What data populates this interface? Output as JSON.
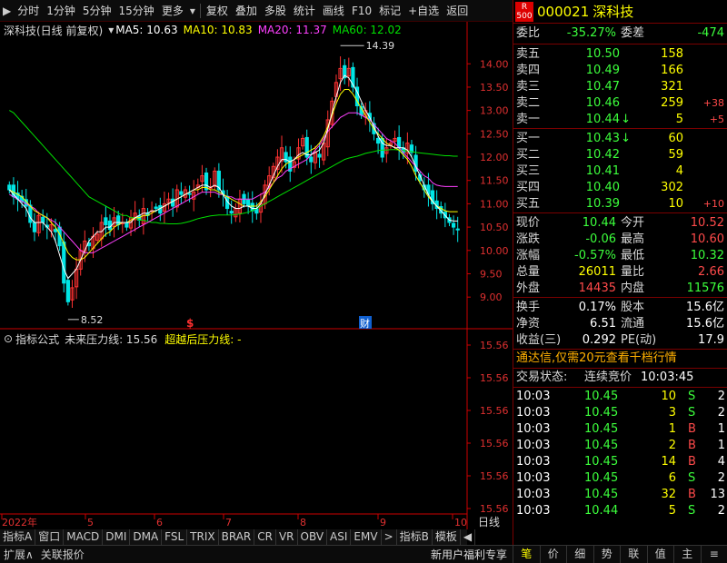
{
  "toolbar": {
    "items": [
      "分时",
      "1分钟",
      "5分钟",
      "15分钟",
      "更多",
      "复权",
      "叠加",
      "多股",
      "统计",
      "画线",
      "F10",
      "标记",
      "+自选",
      "返回"
    ]
  },
  "chart_header": {
    "stock_label": "深科技(日线 前复权)",
    "ma5": "MA5: 10.63",
    "ma10": "MA10: 10.83",
    "ma20": "MA20: 11.37",
    "ma60": "MA60: 12.02"
  },
  "indicator_header": {
    "label": "指标公式",
    "line1": "未来压力线: 15.56",
    "line2": "超越后压力线: -"
  },
  "colors": {
    "up": "#ff3232",
    "down": "#00e5e5",
    "ma5": "#ffffff",
    "ma10": "#ffff00",
    "ma20": "#ff40ff",
    "ma60": "#00e000",
    "axis": "#cc0000",
    "grid_text": "#e03030"
  },
  "chart_data": [
    {
      "type": "candlestick",
      "title": "深科技(日线 前复权)",
      "y_ticks": [
        14.0,
        13.5,
        13.0,
        12.5,
        12.0,
        11.5,
        11.0,
        10.5,
        10.0,
        9.5,
        9.0
      ],
      "ylim": [
        8.4,
        14.55
      ],
      "x_tick_labels": [
        "2022年",
        "5",
        "6",
        "7",
        "8",
        "9",
        "10"
      ],
      "high_marker": "14.39",
      "low_marker": "8.52",
      "event_markers": [
        "$",
        "财"
      ],
      "series": [
        {
          "name": "MA5",
          "value": 10.63
        },
        {
          "name": "MA10",
          "value": 10.83
        },
        {
          "name": "MA20",
          "value": 11.37
        },
        {
          "name": "MA60",
          "value": 12.02
        }
      ],
      "closes": [
        11.3,
        11.15,
        11.1,
        11.05,
        10.95,
        10.6,
        10.4,
        10.75,
        10.6,
        10.5,
        10.55,
        10.4,
        10.1,
        9.3,
        8.9,
        9.2,
        9.6,
        10.0,
        10.2,
        10.1,
        10.3,
        10.35,
        10.6,
        10.55,
        10.45,
        10.7,
        10.55,
        10.6,
        10.5,
        10.7,
        10.8,
        10.65,
        10.9,
        10.75,
        10.85,
        10.9,
        10.8,
        11.0,
        11.1,
        10.95,
        11.3,
        11.2,
        11.3,
        11.2,
        11.25,
        11.4,
        11.6,
        11.3,
        11.35,
        11.7,
        11.3,
        11.2,
        10.9,
        10.8,
        10.9,
        11.1,
        11.0,
        10.95,
        10.85,
        10.8,
        11.0,
        11.4,
        11.6,
        11.8,
        12.0,
        12.2,
        11.9,
        11.7,
        11.9,
        12.2,
        12.4,
        12.0,
        11.9,
        12.1,
        12.0,
        12.3,
        12.8,
        13.2,
        13.6,
        13.9,
        13.7,
        13.9,
        13.5,
        13.1,
        12.9,
        13.0,
        12.8,
        12.5,
        12.3,
        12.0,
        12.2,
        12.3,
        12.4,
        12.2,
        12.1,
        12.3,
        12.1,
        11.7,
        11.5,
        11.3,
        11.2,
        11.0,
        10.9,
        10.8,
        10.7,
        10.6,
        10.5,
        10.44
      ],
      "ma5": [
        11.3,
        11.2,
        11.1,
        11.0,
        10.9,
        10.7,
        10.6,
        10.6,
        10.6,
        10.5,
        10.4,
        10.2,
        9.9,
        9.6,
        9.4,
        9.5,
        9.6,
        9.8,
        10.0,
        10.2,
        10.3,
        10.4,
        10.4,
        10.5,
        10.5,
        10.6,
        10.6,
        10.6,
        10.6,
        10.6,
        10.7,
        10.75,
        10.8,
        10.8,
        10.85,
        10.85,
        10.9,
        10.95,
        11.0,
        11.05,
        11.1,
        11.15,
        11.2,
        11.25,
        11.3,
        11.35,
        11.4,
        11.4,
        11.35,
        11.4,
        11.35,
        11.2,
        11.05,
        10.95,
        10.9,
        10.9,
        10.95,
        10.95,
        10.9,
        10.9,
        11.0,
        11.2,
        11.4,
        11.6,
        11.8,
        11.95,
        11.95,
        11.9,
        11.95,
        12.05,
        12.1,
        12.05,
        12.05,
        12.1,
        12.15,
        12.3,
        12.6,
        12.95,
        13.3,
        13.6,
        13.75,
        13.7,
        13.55,
        13.4,
        13.2,
        13.0,
        12.85,
        12.65,
        12.45,
        12.3,
        12.25,
        12.25,
        12.2,
        12.2,
        12.2,
        12.15,
        12.0,
        11.8,
        11.6,
        11.4,
        11.2,
        11.05,
        10.95,
        10.85,
        10.75,
        10.65,
        10.63,
        10.63
      ],
      "ma10": [
        11.3,
        11.25,
        11.2,
        11.15,
        11.05,
        10.95,
        10.85,
        10.8,
        10.75,
        10.7,
        10.6,
        10.5,
        10.35,
        10.15,
        9.95,
        9.85,
        9.8,
        9.8,
        9.85,
        9.95,
        10.05,
        10.15,
        10.25,
        10.35,
        10.4,
        10.5,
        10.55,
        10.6,
        10.6,
        10.65,
        10.7,
        10.7,
        10.75,
        10.75,
        10.8,
        10.85,
        10.9,
        10.95,
        11.0,
        11.05,
        11.1,
        11.15,
        11.2,
        11.25,
        11.3,
        11.3,
        11.35,
        11.35,
        11.3,
        11.3,
        11.25,
        11.2,
        11.15,
        11.1,
        11.05,
        11.0,
        10.95,
        10.95,
        10.95,
        10.95,
        11.05,
        11.15,
        11.3,
        11.45,
        11.6,
        11.75,
        11.85,
        11.9,
        11.95,
        12.0,
        12.05,
        12.1,
        12.15,
        12.2,
        12.3,
        12.45,
        12.65,
        12.9,
        13.15,
        13.35,
        13.45,
        13.45,
        13.35,
        13.2,
        13.05,
        12.9,
        12.75,
        12.6,
        12.5,
        12.4,
        12.3,
        12.25,
        12.2,
        12.15,
        12.05,
        11.95,
        11.8,
        11.6,
        11.45,
        11.3,
        11.15,
        11.05,
        10.95,
        10.9,
        10.85,
        10.83,
        10.83,
        10.83
      ],
      "ma20": [
        11.2,
        11.15,
        11.1,
        11.05,
        11.0,
        10.95,
        10.9,
        10.8,
        10.75,
        10.7,
        10.65,
        10.6,
        10.5,
        10.4,
        10.3,
        10.2,
        10.1,
        10.0,
        9.95,
        9.95,
        9.95,
        10.0,
        10.05,
        10.1,
        10.15,
        10.2,
        10.25,
        10.3,
        10.35,
        10.4,
        10.45,
        10.5,
        10.55,
        10.6,
        10.65,
        10.7,
        10.75,
        10.8,
        10.85,
        10.9,
        10.95,
        11.0,
        11.05,
        11.1,
        11.15,
        11.2,
        11.25,
        11.25,
        11.25,
        11.25,
        11.2,
        11.2,
        11.15,
        11.15,
        11.1,
        11.1,
        11.1,
        11.1,
        11.1,
        11.15,
        11.2,
        11.25,
        11.35,
        11.45,
        11.55,
        11.6,
        11.7,
        11.75,
        11.8,
        11.85,
        11.9,
        11.95,
        12.05,
        12.15,
        12.25,
        12.4,
        12.55,
        12.65,
        12.75,
        12.85,
        12.9,
        12.95,
        12.95,
        12.95,
        12.9,
        12.85,
        12.8,
        12.7,
        12.6,
        12.5,
        12.4,
        12.35,
        12.3,
        12.2,
        12.1,
        12.0,
        11.9,
        11.8,
        11.7,
        11.6,
        11.55,
        11.45,
        11.4,
        11.38,
        11.37,
        11.37,
        11.37,
        11.37
      ],
      "ma60": [
        13.0,
        12.95,
        12.85,
        12.75,
        12.65,
        12.55,
        12.45,
        12.35,
        12.25,
        12.15,
        12.05,
        11.95,
        11.85,
        11.75,
        11.65,
        11.55,
        11.45,
        11.35,
        11.25,
        11.15,
        11.1,
        11.05,
        11.0,
        10.95,
        10.9,
        10.85,
        10.8,
        10.75,
        10.75,
        10.7,
        10.7,
        10.65,
        10.65,
        10.62,
        10.6,
        10.6,
        10.58,
        10.58,
        10.57,
        10.57,
        10.57,
        10.58,
        10.6,
        10.62,
        10.65,
        10.68,
        10.7,
        10.72,
        10.74,
        10.75,
        10.76,
        10.76,
        10.76,
        10.76,
        10.77,
        10.78,
        10.8,
        10.82,
        10.85,
        10.9,
        10.95,
        11.0,
        11.05,
        11.1,
        11.15,
        11.2,
        11.25,
        11.3,
        11.35,
        11.4,
        11.45,
        11.5,
        11.55,
        11.6,
        11.65,
        11.7,
        11.75,
        11.8,
        11.85,
        11.9,
        11.95,
        11.98,
        12.0,
        12.02,
        12.05,
        12.08,
        12.1,
        12.12,
        12.14,
        12.15,
        12.15,
        12.16,
        12.16,
        12.15,
        12.14,
        12.13,
        12.12,
        12.1,
        12.09,
        12.08,
        12.07,
        12.06,
        12.05,
        12.04,
        12.03,
        12.03,
        12.02,
        12.02
      ]
    },
    {
      "type": "line",
      "title": "指标公式",
      "y_ticks": [
        15.56,
        15.56,
        15.56,
        15.56,
        15.56,
        15.56
      ],
      "series": [
        {
          "name": "未来压力线",
          "value": 15.56
        },
        {
          "name": "超越后压力线",
          "value": "-"
        }
      ]
    }
  ],
  "quote": {
    "badge_top": "R",
    "badge_bottom": "500",
    "code": "000021",
    "name": "深科技",
    "weibi_label": "委比",
    "weibi_value": "-35.27%",
    "weicha_label": "委差",
    "weicha_value": "-474",
    "asks": [
      {
        "label": "卖五",
        "price": "10.50",
        "vol": "158",
        "chg": ""
      },
      {
        "label": "卖四",
        "price": "10.49",
        "vol": "166",
        "chg": ""
      },
      {
        "label": "卖三",
        "price": "10.47",
        "vol": "321",
        "chg": ""
      },
      {
        "label": "卖二",
        "price": "10.46",
        "vol": "259",
        "chg": "+38"
      },
      {
        "label": "卖一",
        "price": "10.44",
        "vol": "5",
        "chg": "+5",
        "arrow": "↓"
      }
    ],
    "bids": [
      {
        "label": "买一",
        "price": "10.43",
        "vol": "60",
        "chg": "",
        "arrow": "↓"
      },
      {
        "label": "买二",
        "price": "10.42",
        "vol": "59",
        "chg": ""
      },
      {
        "label": "买三",
        "price": "10.41",
        "vol": "4",
        "chg": ""
      },
      {
        "label": "买四",
        "price": "10.40",
        "vol": "302",
        "chg": ""
      },
      {
        "label": "买五",
        "price": "10.39",
        "vol": "10",
        "chg": "+10"
      }
    ],
    "stats": [
      {
        "l1": "现价",
        "v1": "10.44",
        "c1": "green",
        "l2": "今开",
        "v2": "10.52",
        "c2": "red"
      },
      {
        "l1": "涨跌",
        "v1": "-0.06",
        "c1": "green",
        "l2": "最高",
        "v2": "10.60",
        "c2": "red"
      },
      {
        "l1": "涨幅",
        "v1": "-0.57%",
        "c1": "green",
        "l2": "最低",
        "v2": "10.32",
        "c2": "green"
      },
      {
        "l1": "总量",
        "v1": "26011",
        "c1": "yellow",
        "l2": "量比",
        "v2": "2.66",
        "c2": "red"
      },
      {
        "l1": "外盘",
        "v1": "14435",
        "c1": "red",
        "l2": "内盘",
        "v2": "11576",
        "c2": "green"
      }
    ],
    "finance": [
      {
        "l1": "换手",
        "v1": "0.17%",
        "l2": "股本",
        "v2": "15.6亿"
      },
      {
        "l1": "净资",
        "v1": "6.51",
        "l2": "流通",
        "v2": "15.6亿"
      },
      {
        "l1": "收益(三)",
        "v1": "0.292",
        "l2": "PE(动)",
        "v2": "17.9"
      }
    ],
    "promo": "通达信,仅需20元查看千档行情",
    "trade_status_label": "交易状态:",
    "trade_status_value": "连续竞价",
    "trade_status_time": "10:03:45",
    "ticks": [
      {
        "time": "10:03",
        "price": "10.45",
        "vol": "10",
        "bs": "S",
        "n": "2"
      },
      {
        "time": "10:03",
        "price": "10.45",
        "vol": "3",
        "bs": "S",
        "n": "2"
      },
      {
        "time": "10:03",
        "price": "10.45",
        "vol": "1",
        "bs": "B",
        "n": "1"
      },
      {
        "time": "10:03",
        "price": "10.45",
        "vol": "2",
        "bs": "B",
        "n": "1"
      },
      {
        "time": "10:03",
        "price": "10.45",
        "vol": "14",
        "bs": "B",
        "n": "4"
      },
      {
        "time": "10:03",
        "price": "10.45",
        "vol": "6",
        "bs": "S",
        "n": "2"
      },
      {
        "time": "10:03",
        "price": "10.45",
        "vol": "32",
        "bs": "B",
        "n": "13"
      },
      {
        "time": "10:03",
        "price": "10.44",
        "vol": "5",
        "bs": "S",
        "n": "2"
      }
    ]
  },
  "tabs": [
    "指标A",
    "窗口",
    "MACD",
    "DMI",
    "DMA",
    "FSL",
    "TRIX",
    "BRAR",
    "CR",
    "VR",
    "OBV",
    "ASI",
    "EMV",
    ">",
    "指标B",
    "模板",
    "◀"
  ],
  "period_label": "日线",
  "statusbar": {
    "left1": "扩展∧",
    "left2": "关联报价",
    "right": "新用户福利专享"
  },
  "quote_tabs": [
    "笔",
    "价",
    "细",
    "势",
    "联",
    "值",
    "主",
    "≡"
  ]
}
